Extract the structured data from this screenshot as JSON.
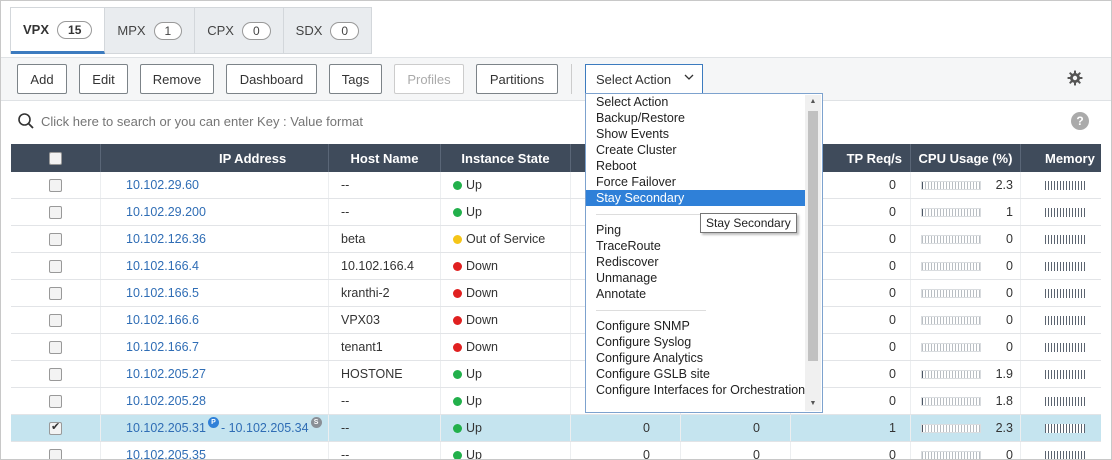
{
  "tabs": [
    {
      "label": "VPX",
      "count": "15"
    },
    {
      "label": "MPX",
      "count": "1"
    },
    {
      "label": "CPX",
      "count": "0"
    },
    {
      "label": "SDX",
      "count": "0"
    }
  ],
  "toolbar": {
    "add": "Add",
    "edit": "Edit",
    "remove": "Remove",
    "dashboard": "Dashboard",
    "tags": "Tags",
    "profiles": "Profiles",
    "partitions": "Partitions",
    "select_action": "Select Action"
  },
  "search": {
    "placeholder": "Click here to search or you can enter Key : Value format"
  },
  "help_label": "?",
  "table": {
    "headers": [
      "",
      "IP Address",
      "Host Name",
      "Instance State",
      "",
      "",
      "TP Req/s",
      "CPU Usage (%)",
      "Memory"
    ],
    "rows": [
      {
        "ip": "10.102.29.60",
        "host": "--",
        "state": "Up",
        "col5": "",
        "col6": "",
        "req": "0",
        "cpu": "2.3",
        "cpu_frac": 0.05,
        "checked": false
      },
      {
        "ip": "10.102.29.200",
        "host": "--",
        "state": "Up",
        "col5": "",
        "col6": "",
        "req": "0",
        "cpu": "1",
        "cpu_frac": 0.02,
        "checked": false
      },
      {
        "ip": "10.102.126.36",
        "host": "beta",
        "state": "Out of Service",
        "col5": "",
        "col6": "",
        "req": "0",
        "cpu": "0",
        "cpu_frac": 0,
        "checked": false
      },
      {
        "ip": "10.102.166.4",
        "host": "10.102.166.4",
        "state": "Down",
        "col5": "",
        "col6": "",
        "req": "0",
        "cpu": "0",
        "cpu_frac": 0,
        "checked": false
      },
      {
        "ip": "10.102.166.5",
        "host": "kranthi-2",
        "state": "Down",
        "col5": "",
        "col6": "",
        "req": "0",
        "cpu": "0",
        "cpu_frac": 0,
        "checked": false
      },
      {
        "ip": "10.102.166.6",
        "host": "VPX03",
        "state": "Down",
        "col5": "",
        "col6": "",
        "req": "0",
        "cpu": "0",
        "cpu_frac": 0,
        "checked": false
      },
      {
        "ip": "10.102.166.7",
        "host": "tenant1",
        "state": "Down",
        "col5": "",
        "col6": "",
        "req": "0",
        "cpu": "0",
        "cpu_frac": 0,
        "checked": false
      },
      {
        "ip": "10.102.205.27",
        "host": "HOSTONE",
        "state": "Up",
        "col5": "",
        "col6": "",
        "req": "0",
        "cpu": "1.9",
        "cpu_frac": 0.04,
        "checked": false
      },
      {
        "ip": "10.102.205.28",
        "host": "--",
        "state": "Up",
        "col5": "",
        "col6": "",
        "req": "0",
        "cpu": "1.8",
        "cpu_frac": 0.04,
        "checked": false
      },
      {
        "ip": "10.102.205.31",
        "ip2": "10.102.205.34",
        "sep": "-",
        "badge1": "P",
        "badge2": "S",
        "host": "--",
        "state": "Up",
        "col5": "0",
        "col6": "0",
        "req": "1",
        "cpu": "2.3",
        "cpu_frac": 0.05,
        "checked": true
      },
      {
        "ip": "10.102.205.35",
        "host": "--",
        "state": "Up",
        "col5": "0",
        "col6": "0",
        "req": "0",
        "cpu": "0",
        "cpu_frac": 0,
        "checked": false
      }
    ]
  },
  "state_colors": {
    "Up": "#22b04b",
    "Out of Service": "#f5c518",
    "Down": "#e02020"
  },
  "dropdown": {
    "items": [
      "Select Action",
      "Backup/Restore",
      "Show Events",
      "Create Cluster",
      "Reboot",
      "Force Failover",
      "Stay Secondary",
      "",
      "Ping",
      "TraceRoute",
      "Rediscover",
      "Unmanage",
      "Annotate",
      "",
      "Configure SNMP",
      "Configure Syslog",
      "Configure Analytics",
      "Configure GSLB site",
      "Configure Interfaces for Orchestration"
    ],
    "highlighted": "Stay Secondary"
  },
  "tooltip": "Stay Secondary",
  "icons": {
    "gear": "gear-icon",
    "search": "search-icon",
    "help": "help-icon",
    "chevron": "chevron-down-icon"
  }
}
